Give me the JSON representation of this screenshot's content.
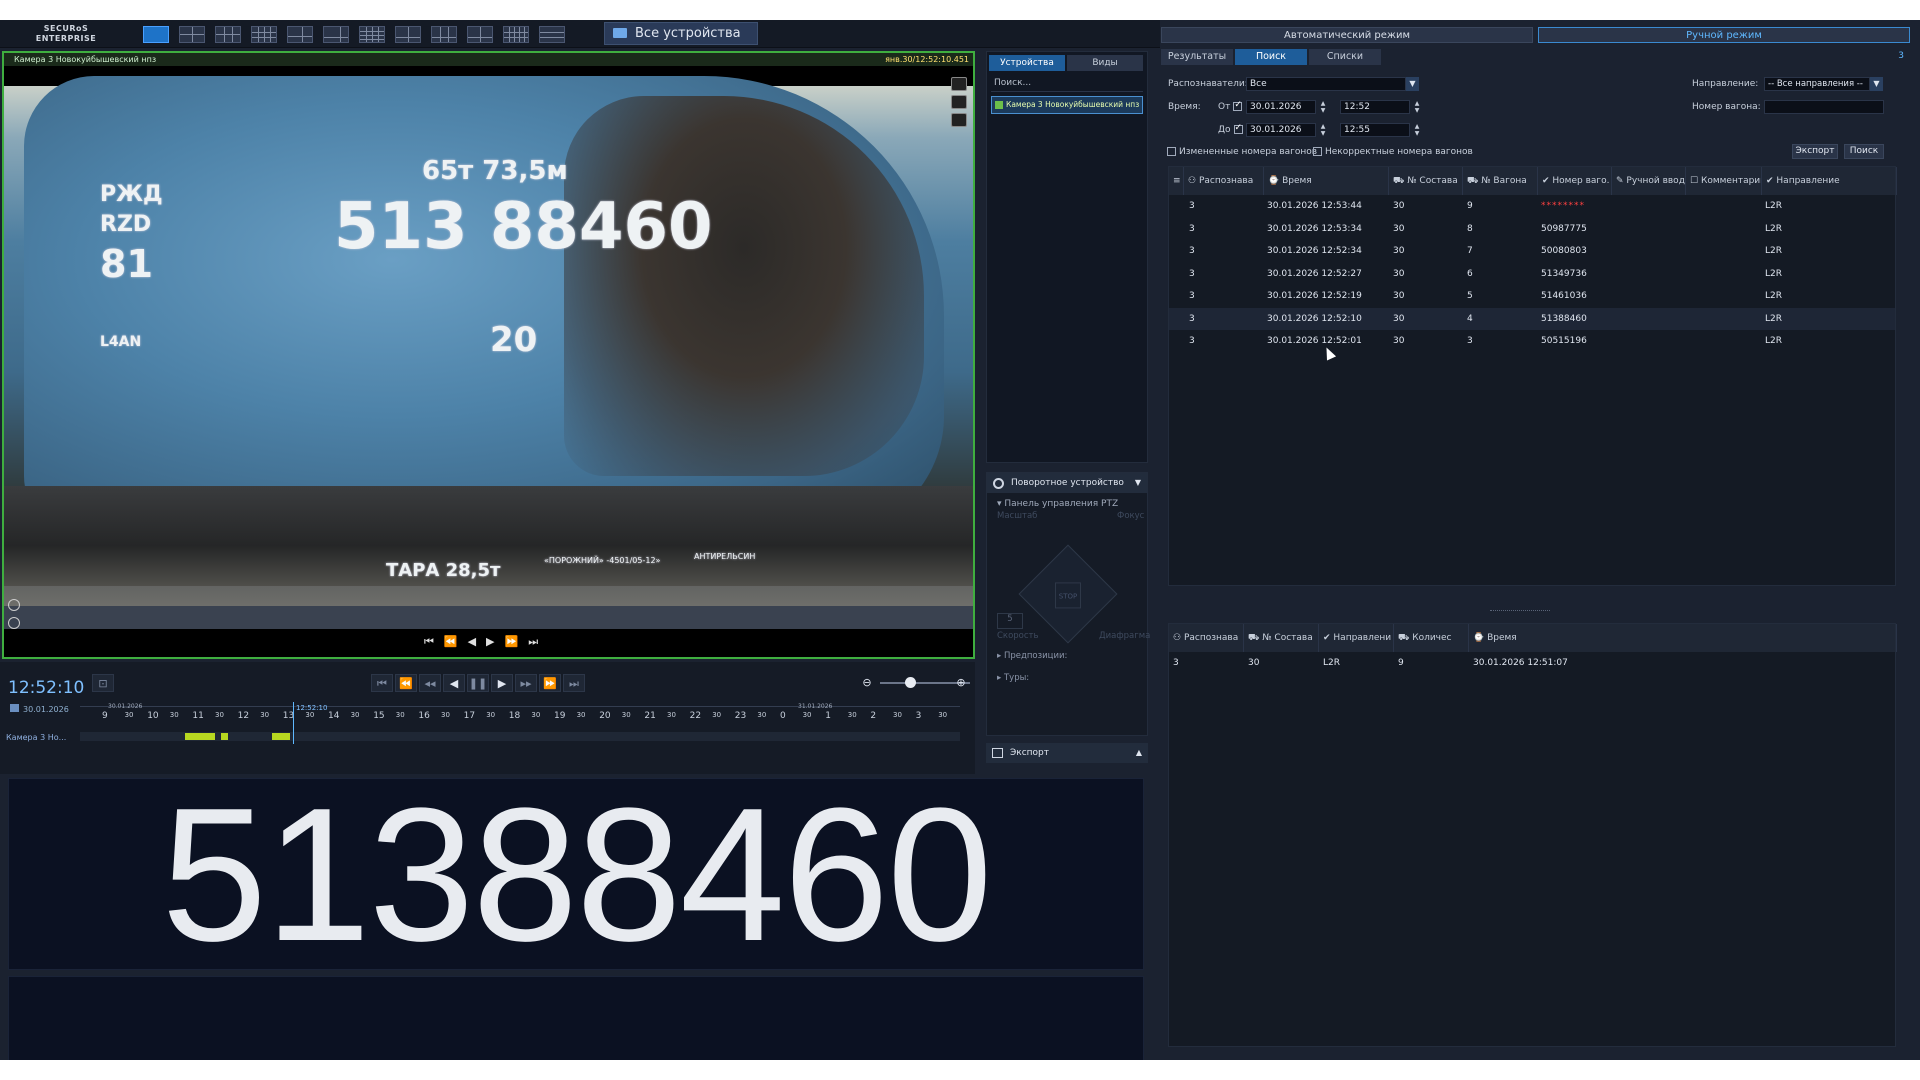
{
  "topbar": {
    "logo_line1": "SECURoS",
    "logo_line2": "ENTERPRISE",
    "all_devices": "Все устройства"
  },
  "video": {
    "camera_title": "Камера 3 Новокуйбышевский нпз",
    "timestamp": "янв.30/12:52:10.451",
    "stencil_top": "65т 73,5м",
    "stencil_number": "513 88460",
    "stencil_left1": "РЖД",
    "stencil_left2": "RZD",
    "stencil_left3": "81",
    "stencil_l4an": "L4AN",
    "stencil_20": "20",
    "stencil_tara": "ТАРА 28,5т",
    "stencil_porozh": "«ПОРОЖНИЙ» -4501/05-12»",
    "stencil_antirelsin": "АНТИРЕЛЬСИН"
  },
  "timeline": {
    "time": "12:52:10",
    "date": "30.01.2026",
    "camera_label": "Камера 3 Но...",
    "cursor_label": "12:52:10",
    "day_label_left": "30.01.2026",
    "day_label_right": "31.01.2026",
    "hours": [
      "9",
      "30",
      "10",
      "30",
      "11",
      "30",
      "12",
      "30",
      "13",
      "30",
      "14",
      "30",
      "15",
      "30",
      "16",
      "30",
      "17",
      "30",
      "18",
      "30",
      "19",
      "30",
      "20",
      "30",
      "21",
      "30",
      "22",
      "30",
      "23",
      "30",
      "0",
      "30",
      "1",
      "30",
      "2",
      "30",
      "3",
      "30"
    ]
  },
  "recognized_number": "51388460",
  "middle_panel": {
    "tabs": [
      "Устройства",
      "Виды"
    ],
    "search_placeholder": "Поиск...",
    "camera_item": "Камера 3 Новокуйбышевский нпз",
    "ptz_header": "Поворотное устройство",
    "ptz_panel": "Панель управления PTZ",
    "zoom_label": "Масштаб",
    "focus_label": "Фокус",
    "stop_label": "STOP",
    "speed_label": "Скорость",
    "speed_value": "5",
    "iris_label": "Диафрагма",
    "presets_label": "Предпозиции:",
    "tours_label": "Туры:",
    "export_label": "Экспорт"
  },
  "right_panel": {
    "mode_auto": "Автоматический режим",
    "mode_manual": "Ручной режим",
    "tabs": [
      "Результаты",
      "Поиск",
      "Списки"
    ],
    "page_number": "3",
    "recognizers_label": "Распознаватели:",
    "recognizers_value": "Все",
    "time_label": "Время:",
    "from_label": "От",
    "to_label": "До",
    "from_date": "30.01.2026",
    "from_time": "12:52",
    "to_date": "30.01.2026",
    "to_time": "12:55",
    "direction_label": "Направление:",
    "direction_value": "-- Все направления --",
    "wagon_number_label": "Номер вагона:",
    "changed_numbers": "Измененные номера вагонов",
    "incorrect_numbers": "Некорректные номера вагонов",
    "export_btn": "Экспорт",
    "search_btn": "Поиск",
    "columns": [
      "Распознава",
      "Время",
      "№ Состава",
      "№ Вагона",
      "Номер ваго.",
      "Ручной ввод",
      "Комментарии",
      "Направление"
    ],
    "rows": [
      {
        "rec": "3",
        "time": "30.01.2026 12:53:44",
        "train": "30",
        "wagon": "9",
        "number": "********",
        "dir": "L2R"
      },
      {
        "rec": "3",
        "time": "30.01.2026 12:53:34",
        "train": "30",
        "wagon": "8",
        "number": "50987775",
        "dir": "L2R"
      },
      {
        "rec": "3",
        "time": "30.01.2026 12:52:34",
        "train": "30",
        "wagon": "7",
        "number": "50080803",
        "dir": "L2R"
      },
      {
        "rec": "3",
        "time": "30.01.2026 12:52:27",
        "train": "30",
        "wagon": "6",
        "number": "51349736",
        "dir": "L2R"
      },
      {
        "rec": "3",
        "time": "30.01.2026 12:52:19",
        "train": "30",
        "wagon": "5",
        "number": "51461036",
        "dir": "L2R"
      },
      {
        "rec": "3",
        "time": "30.01.2026 12:52:10",
        "train": "30",
        "wagon": "4",
        "number": "51388460",
        "dir": "L2R"
      },
      {
        "rec": "3",
        "time": "30.01.2026 12:52:01",
        "train": "30",
        "wagon": "3",
        "number": "50515196",
        "dir": "L2R"
      }
    ],
    "columns2": [
      "Распознава",
      "№ Состава",
      "Направлени",
      "Количес",
      "Время"
    ],
    "rows2": [
      {
        "rec": "3",
        "train": "30",
        "dir": "L2R",
        "count": "9",
        "time": "30.01.2026 12:51:07"
      }
    ]
  }
}
